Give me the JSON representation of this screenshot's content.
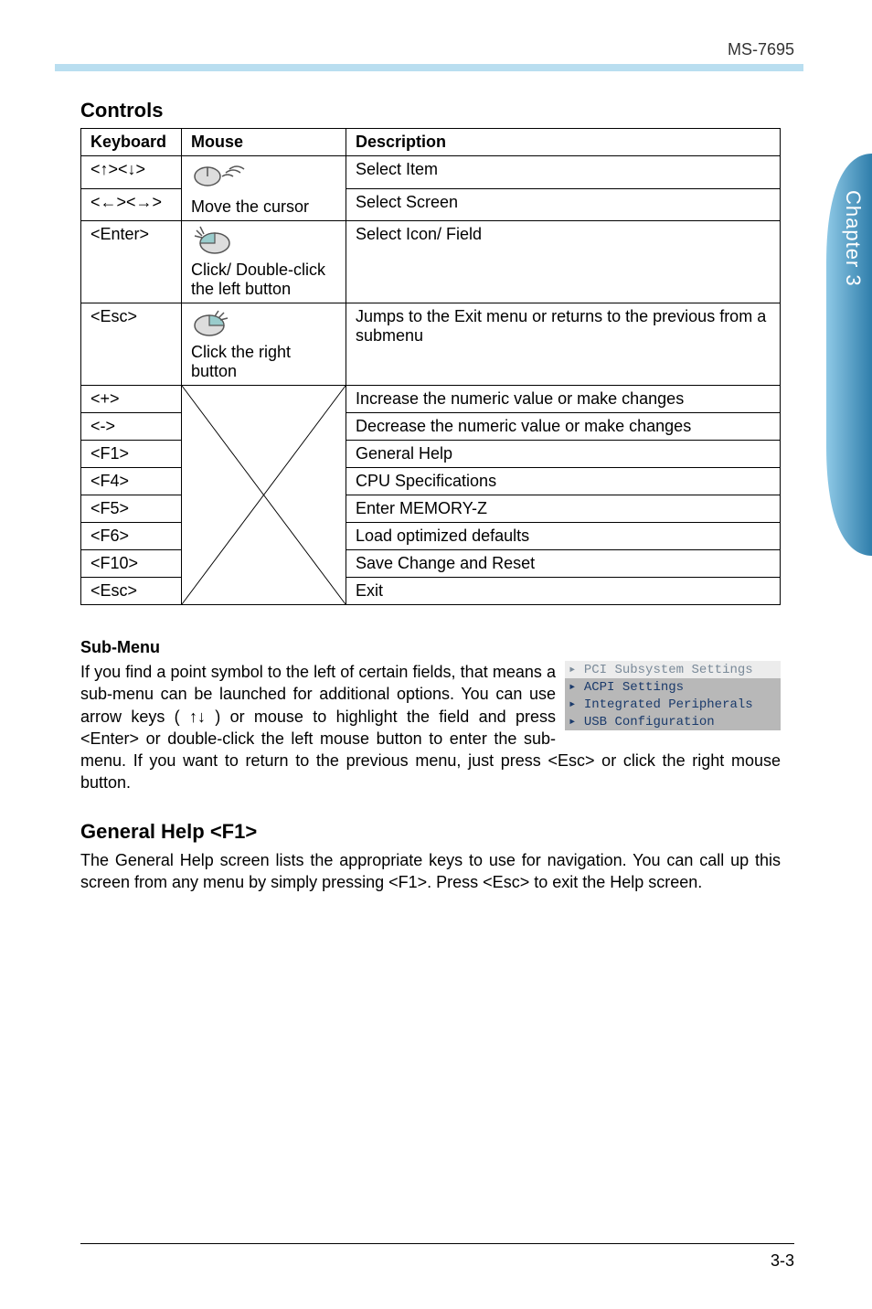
{
  "doc_label": "MS-7695",
  "controls": {
    "heading": "Controls",
    "headers": {
      "keyboard": "Keyboard",
      "mouse": "Mouse",
      "description": "Description"
    },
    "mouse_move": "Move the cursor",
    "mouse_click": "Click/ Double-click the left button",
    "mouse_rclick": "Click the right button",
    "rows": [
      {
        "key": "<↑><↓>",
        "desc": "Select Item"
      },
      {
        "key": "<←><→>",
        "desc": "Select Screen"
      },
      {
        "key": "<Enter>",
        "desc": "Select  Icon/ Field"
      },
      {
        "key": "<Esc>",
        "desc": "Jumps to the Exit menu or returns to the previous from a submenu"
      },
      {
        "key": "<+>",
        "desc": "Increase the numeric value or make changes"
      },
      {
        "key": "<->",
        "desc": "Decrease the numeric value or make changes"
      },
      {
        "key": "<F1>",
        "desc": "General Help"
      },
      {
        "key": "<F4>",
        "desc": "CPU Specifications"
      },
      {
        "key": "<F5>",
        "desc": "Enter MEMORY-Z"
      },
      {
        "key": "<F6>",
        "desc": "Load optimized defaults"
      },
      {
        "key": "<F10>",
        "desc": "Save Change and Reset"
      },
      {
        "key": "<Esc>",
        "desc": "Exit"
      }
    ]
  },
  "submenu": {
    "heading": "Sub-Menu",
    "text": "If you find a point symbol to the left of certain fields, that means a sub-menu can be launched for additional options. You can use arrow keys  ( ↑↓ )  or mouse to highlight the field and press <Enter> or double-click the left mouse button to enter the sub-menu. If you want to return to the previous menu, just press <Esc> or click the right mouse button.",
    "list": {
      "items": [
        "PCI Subsystem Settings",
        "ACPI Settings",
        "Integrated Peripherals",
        "USB Configuration"
      ]
    }
  },
  "general_help": {
    "heading": "General Help <F1>",
    "text": "The General Help screen lists the appropriate keys to use for navigation.  You can call up this screen from any menu by simply pressing <F1>.  Press <Esc> to exit the Help screen."
  },
  "side_tab": "Chapter 3",
  "page_number": "3-3"
}
